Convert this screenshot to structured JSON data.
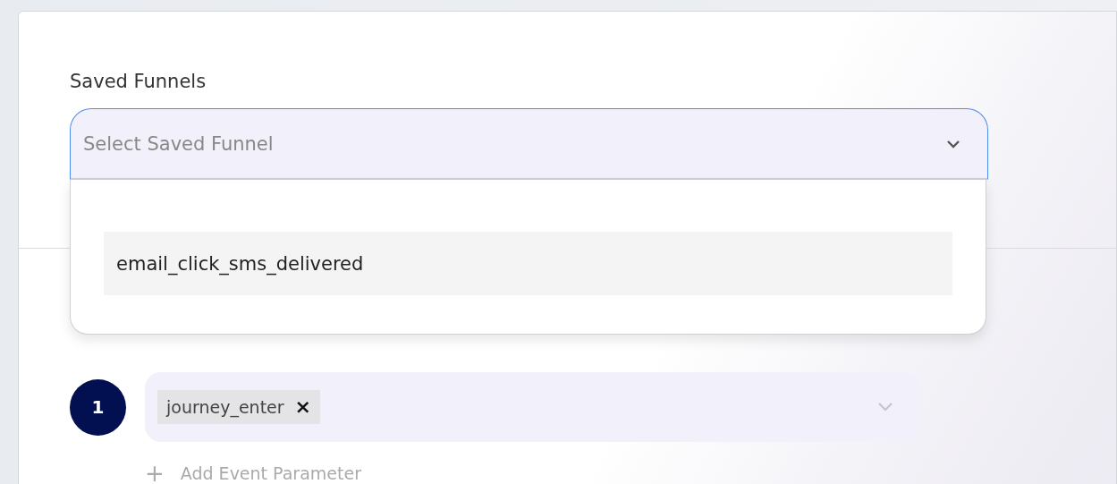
{
  "saved_funnels": {
    "label": "Saved Funnels",
    "placeholder": "Select Saved Funnel",
    "expanded": true,
    "options": [
      {
        "label": "email_click_sms_delivered",
        "selected": false
      }
    ]
  },
  "steps": [
    {
      "number": "1",
      "events": [
        {
          "label": "journey_enter",
          "remove": "×"
        }
      ],
      "add_parameter": {
        "icon": "+",
        "label": "Add Event Parameter"
      }
    }
  ]
}
